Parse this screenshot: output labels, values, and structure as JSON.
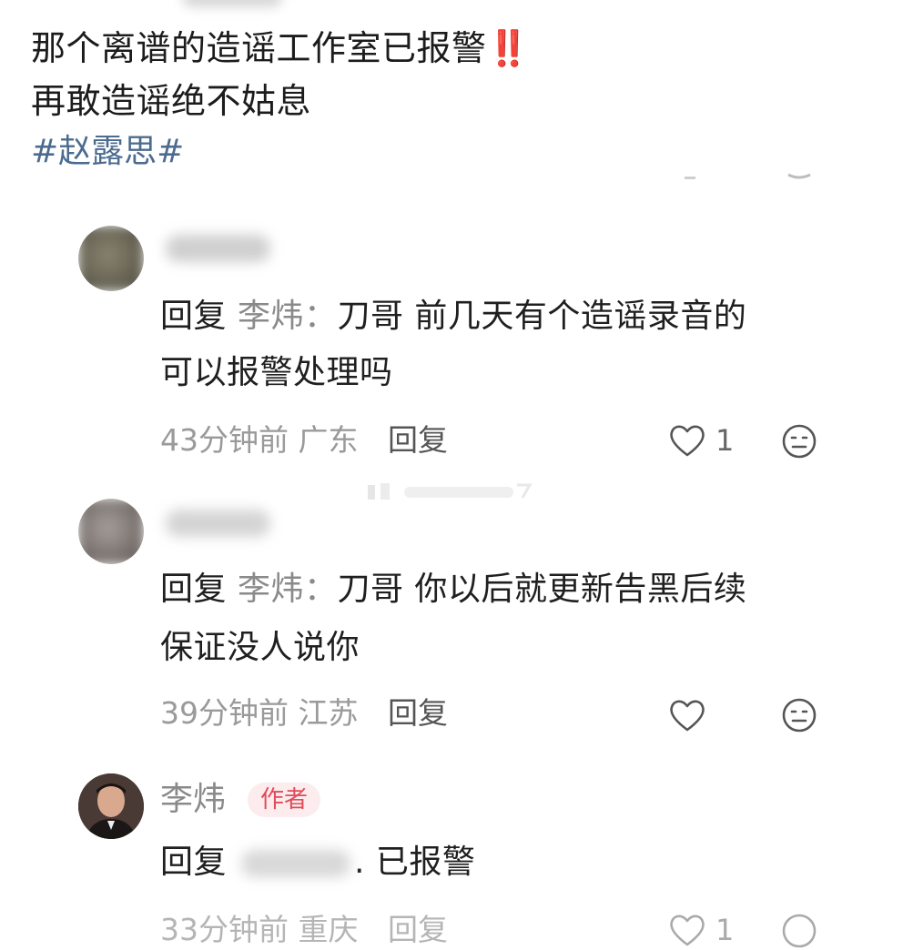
{
  "post": {
    "line1": "那个离谱的造谣工作室已报警",
    "line1_emoji": "‼️",
    "line2": "再敢造谣绝不姑息",
    "hashtag": "#赵露思#"
  },
  "comments": [
    {
      "reply_prefix": "回复",
      "reply_to": "李炜：",
      "text_line1": "刀哥 前几天有个造谣录音的",
      "text_line2": "可以报警处理吗",
      "time": "43分钟前",
      "location": "广东",
      "reply_label": "回复",
      "likes": "1",
      "avatar_color": "#6e6a5a"
    },
    {
      "reply_prefix": "回复",
      "reply_to": "李炜：",
      "text_line1": "刀哥 你以后就更新告黑后续",
      "text_line2": "保证没人说你",
      "time": "39分钟前",
      "location": "江苏",
      "reply_label": "回复",
      "likes": "",
      "avatar_color": "#8a8482"
    }
  ],
  "author_comment": {
    "name": "李炜",
    "badge": "作者",
    "reply_prefix": "回复",
    "text": ". 已报警",
    "time": "33分钟前",
    "location": "重庆",
    "reply_label": "回复",
    "likes": "1"
  },
  "icons": {
    "like": "heart-outline-icon",
    "emoji": "neutral-face-icon"
  },
  "colors": {
    "hashtag": "#4b6b8f",
    "alert": "#e8322e",
    "author_badge_bg": "#fdecee",
    "author_badge_text": "#e04b5a"
  }
}
